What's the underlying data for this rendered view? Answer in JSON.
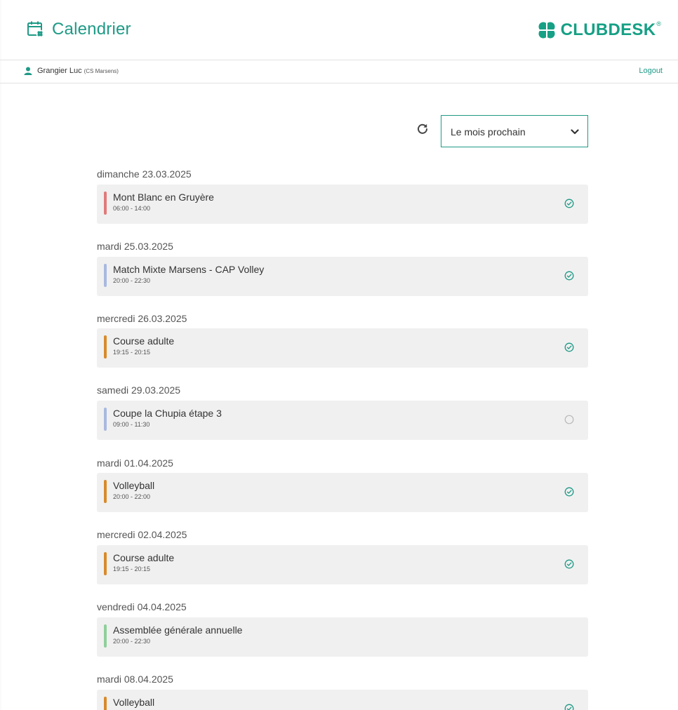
{
  "header": {
    "title": "Calendrier",
    "calendar_icon": "calendar-icon",
    "brand": {
      "name": "CLUBDESK",
      "reg": "®",
      "icon": "clover-icon",
      "color": "#16a085"
    }
  },
  "userbar": {
    "user_name": "Grangier Luc",
    "user_club": "(CS Marsens)",
    "user_icon": "user-icon",
    "logout_label": "Logout"
  },
  "toolbar": {
    "refresh_icon": "refresh-icon",
    "period_selected": "Le mois prochain",
    "chevron_icon": "chevron-down-icon"
  },
  "colors": {
    "accent": "#1e9a86",
    "red": "#e07a7a",
    "blue": "#a8b8e0",
    "orange": "#d98a2b",
    "green": "#8fcf9a"
  },
  "days": [
    {
      "date": "dimanche 23.03.2025",
      "event": {
        "title": "Mont Blanc en Gruyère",
        "time": "06:00 - 14:00",
        "color": "#e07a7a",
        "status": "confirmed"
      }
    },
    {
      "date": "mardi 25.03.2025",
      "event": {
        "title": "Match Mixte Marsens - CAP Volley",
        "time": "20:00 - 22:30",
        "color": "#a8b8e0",
        "status": "confirmed"
      }
    },
    {
      "date": "mercredi 26.03.2025",
      "event": {
        "title": "Course adulte",
        "time": "19:15 - 20:15",
        "color": "#d98a2b",
        "status": "confirmed"
      }
    },
    {
      "date": "samedi 29.03.2025",
      "event": {
        "title": "Coupe la Chupia étape 3",
        "time": "09:00 - 11:30",
        "color": "#a8b8e0",
        "status": "open"
      }
    },
    {
      "date": "mardi 01.04.2025",
      "event": {
        "title": "Volleyball",
        "time": "20:00 - 22:00",
        "color": "#d98a2b",
        "status": "confirmed"
      }
    },
    {
      "date": "mercredi 02.04.2025",
      "event": {
        "title": "Course adulte",
        "time": "19:15 - 20:15",
        "color": "#d98a2b",
        "status": "confirmed"
      }
    },
    {
      "date": "vendredi 04.04.2025",
      "event": {
        "title": "Assemblée générale annuelle",
        "time": "20:00 - 22:30",
        "color": "#8fcf9a",
        "status": "none"
      }
    },
    {
      "date": "mardi 08.04.2025",
      "event": {
        "title": "Volleyball",
        "time": "",
        "color": "#d98a2b",
        "status": "confirmed"
      }
    }
  ]
}
